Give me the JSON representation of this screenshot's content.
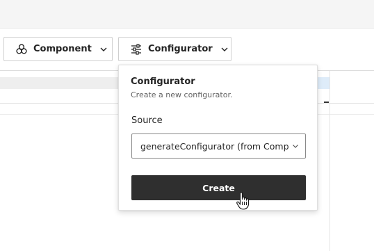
{
  "toolbar": {
    "component_label": "Component",
    "configurator_label": "Configurator"
  },
  "popover": {
    "title": "Configurator",
    "subtitle": "Create a new configurator.",
    "source_label": "Source",
    "source_value": "generateConfigurator (from Comp",
    "create_label": "Create"
  },
  "icons": {
    "component": "component-cluster-icon",
    "configurator": "sliders-icon",
    "dropdown": "chevron-down-icon",
    "cursor": "hand-pointer-icon"
  },
  "colors": {
    "create_button_bg": "#2f2f2f",
    "highlight_blue": "#deecf9"
  }
}
